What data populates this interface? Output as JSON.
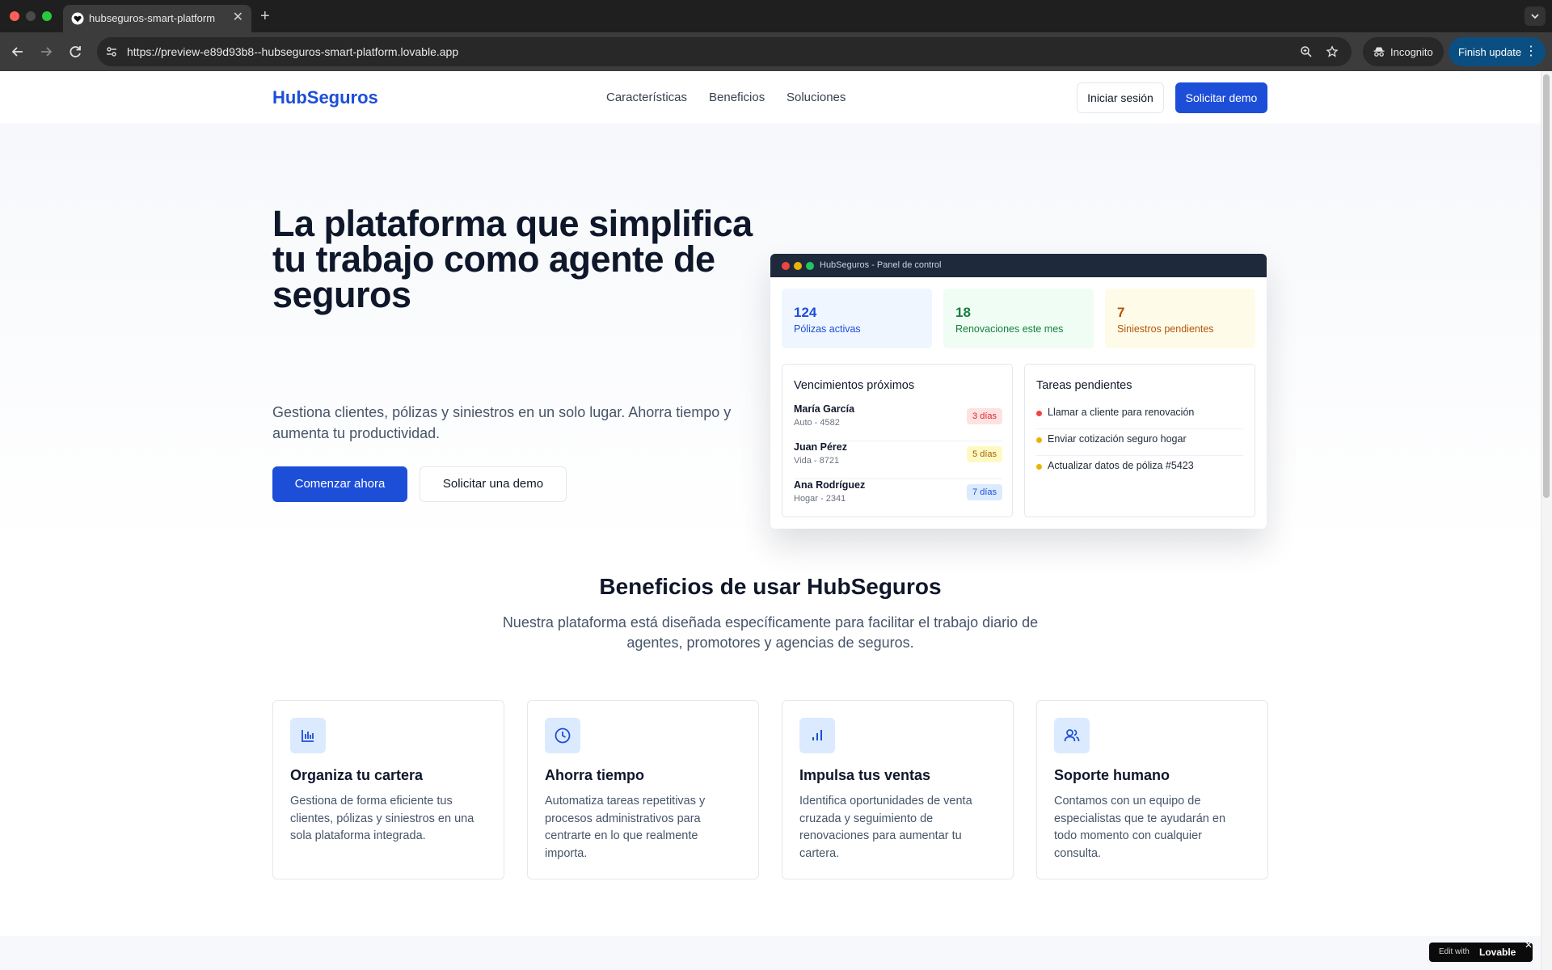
{
  "browser": {
    "tab_title": "hubseguros-smart-platform",
    "url": "https://preview-e89d93b8--hubseguros-smart-platform.lovable.app",
    "incognito_label": "Incognito",
    "finish_update_label": "Finish update",
    "new_tab_glyph": "+",
    "close_glyph": "✕",
    "menu_glyph": "⋮"
  },
  "header": {
    "logo": "HubSeguros",
    "nav": [
      "Características",
      "Beneficios",
      "Soluciones"
    ],
    "login_label": "Iniciar sesión",
    "demo_label": "Solicitar demo"
  },
  "hero": {
    "title": "La plataforma que simplifica tu trabajo como agente de seguros",
    "subtitle_lines": [
      "Gestiona clientes, pólizas y siniestros en un solo lugar. Ahorra tiempo y",
      "aumenta tu productividad."
    ],
    "cta_primary": "Comenzar ahora",
    "cta_secondary": "Solicitar una demo"
  },
  "dashboard": {
    "window_title": "HubSeguros - Panel de control",
    "stats": [
      {
        "value": "124",
        "label": "Pólizas activas",
        "color": "#1d4ed8",
        "bg": "#eff6ff"
      },
      {
        "value": "18",
        "label": "Renovaciones este mes",
        "color": "#15803d",
        "bg": "#f0fdf4"
      },
      {
        "value": "7",
        "label": "Siniestros pendientes",
        "color": "#b45309",
        "bg": "#fefce8"
      }
    ],
    "due_title": "Vencimientos próximos",
    "due_items": [
      {
        "name": "María García",
        "detail": "Auto - 4582",
        "badge": "3 días",
        "badge_color": "#dc2626",
        "badge_bg": "#fee2e2"
      },
      {
        "name": "Juan Pérez",
        "detail": "Vida - 8721",
        "badge": "5 días",
        "badge_color": "#a16207",
        "badge_bg": "#fef9c3"
      },
      {
        "name": "Ana Rodríguez",
        "detail": "Hogar - 2341",
        "badge": "7 días",
        "badge_color": "#1d4ed8",
        "badge_bg": "#dbeafe"
      }
    ],
    "tasks_title": "Tareas pendientes",
    "tasks": [
      {
        "text": "Llamar a cliente para renovación",
        "dot_color": "#ef4444"
      },
      {
        "text": "Enviar cotización seguro hogar",
        "dot_color": "#eab308"
      },
      {
        "text": "Actualizar datos de póliza #5423",
        "dot_color": "#eab308"
      }
    ]
  },
  "benefits": {
    "title": "Beneficios de usar HubSeguros",
    "subtitle_lines": [
      "Nuestra plataforma está diseñada específicamente para facilitar el trabajo diario de",
      "agentes, promotores y agencias de seguros."
    ],
    "cards": [
      {
        "icon": "bar-chart-icon",
        "title": "Organiza tu cartera",
        "lines": [
          "Gestiona de forma eficiente tus",
          "clientes, pólizas y siniestros en una",
          "sola plataforma integrada."
        ]
      },
      {
        "icon": "clock-icon",
        "title": "Ahorra tiempo",
        "lines": [
          "Automatiza tareas repetitivas y",
          "procesos administrativos para",
          "centrarte en lo que realmente",
          "importa."
        ]
      },
      {
        "icon": "signal-chart-icon",
        "title": "Impulsa tus ventas",
        "lines": [
          "Identifica oportunidades de venta",
          "cruzada y seguimiento de",
          "renovaciones para aumentar tu",
          "cartera."
        ]
      },
      {
        "icon": "users-icon",
        "title": "Soporte humano",
        "lines": [
          "Contamos con un equipo de",
          "especialistas que te ayudarán en",
          "todo momento con cualquier",
          "consulta."
        ]
      }
    ]
  },
  "lovable_badge": {
    "prefix": "Edit with",
    "brand": "Lovable",
    "close_glyph": "✕"
  },
  "colors": {
    "brand": "#1d4ed8",
    "chrome_dark": "#1f1f1f",
    "finish_update_bg": "#0b4f82"
  }
}
